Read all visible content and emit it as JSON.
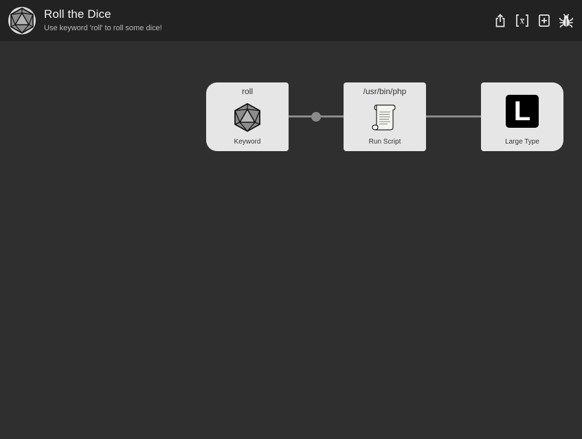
{
  "header": {
    "title": "Roll the Dice",
    "subtitle": "Use keyword 'roll' to roll some dice!",
    "app_icon": "d20-dice-icon",
    "toolbar": [
      {
        "name": "export-share",
        "icon": "share-icon"
      },
      {
        "name": "variables",
        "icon": "variables-icon"
      },
      {
        "name": "add-object",
        "icon": "add-box-icon"
      },
      {
        "name": "debug",
        "icon": "bug-icon"
      }
    ]
  },
  "nodes": [
    {
      "id": "keyword",
      "top_text": "roll",
      "label": "Keyword",
      "icon": "d20-dice-icon"
    },
    {
      "id": "run-script",
      "top_text": "/usr/bin/php",
      "label": "Run Script",
      "icon": "scroll-icon"
    },
    {
      "id": "large-type",
      "top_text": "",
      "label": "Large Type",
      "icon": "large-type-icon",
      "glyph": "L"
    }
  ],
  "colors": {
    "canvas": "#2f2f2f",
    "header": "#222222",
    "node": "#e6e6e6",
    "connector": "#8a8a8a"
  }
}
